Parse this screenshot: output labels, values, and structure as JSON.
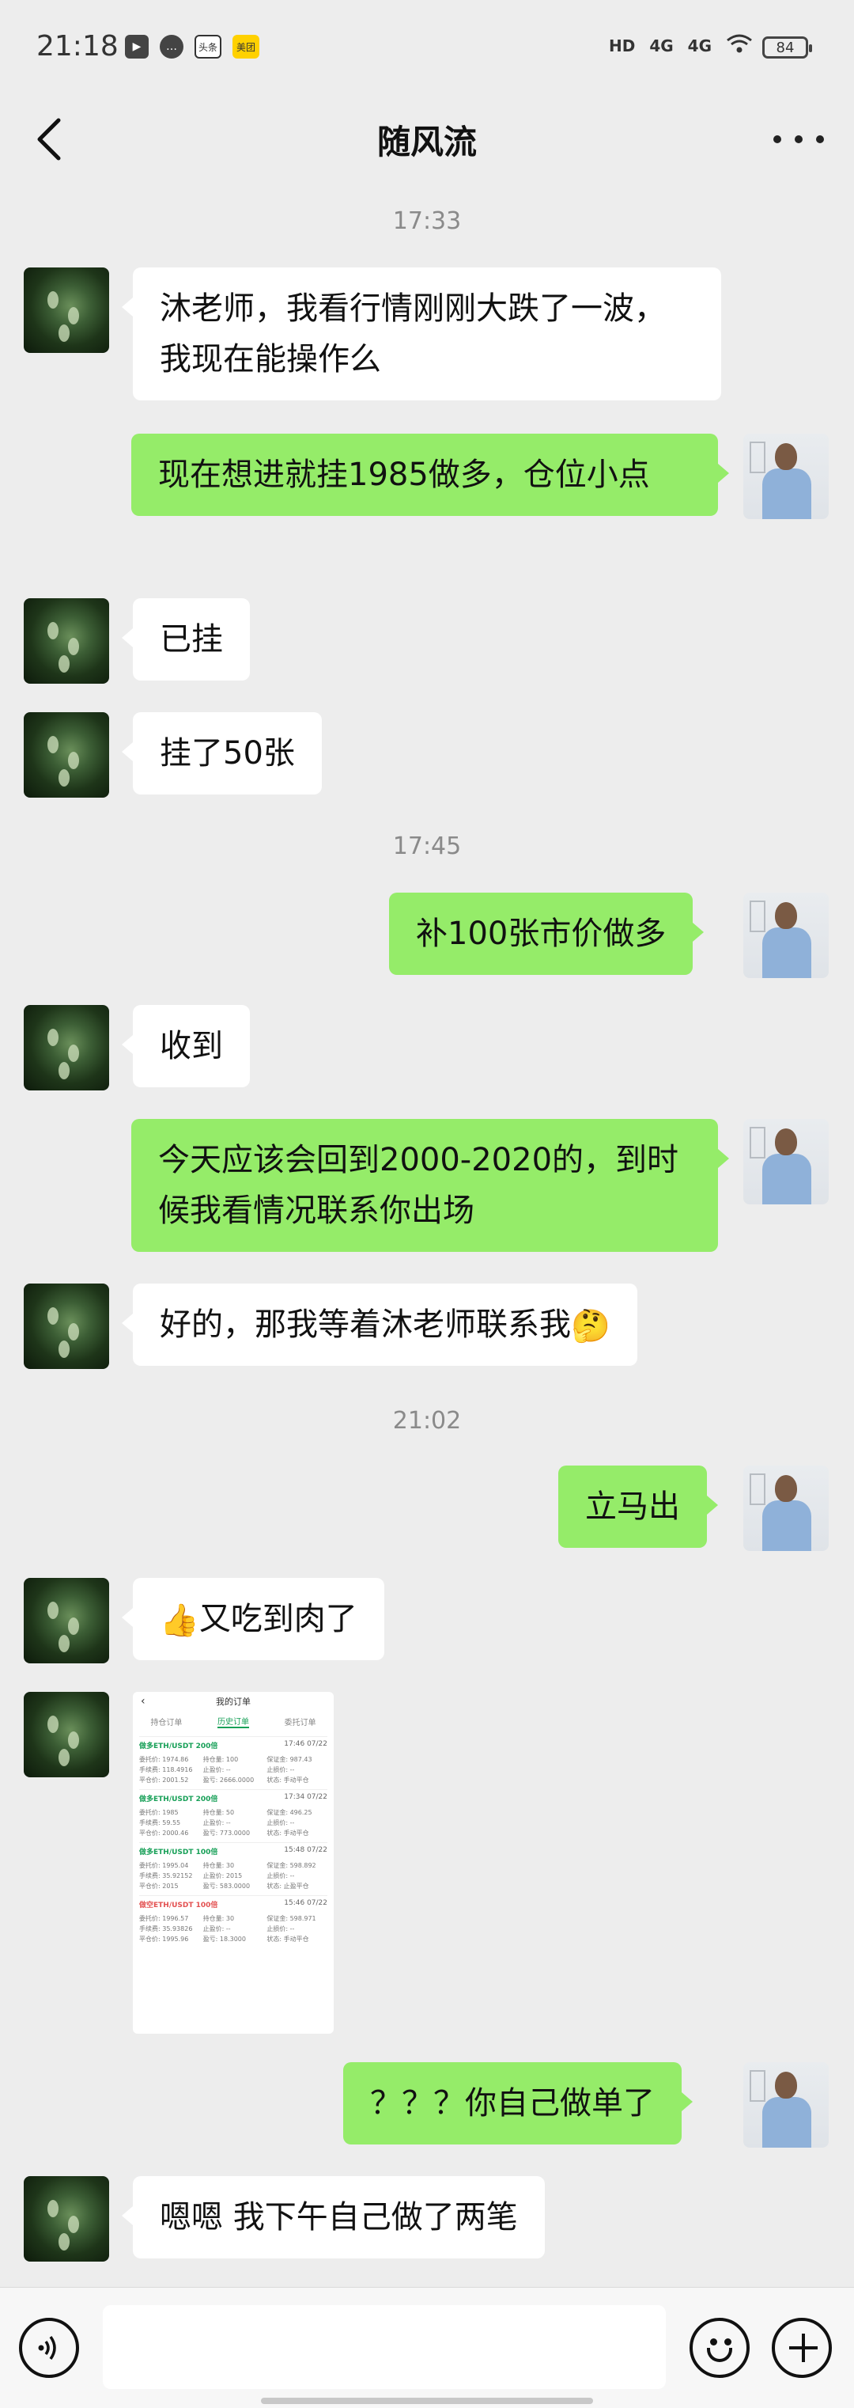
{
  "status_bar": {
    "time": "21:18",
    "icons_left": [
      "play-icon",
      "chat-bubble-icon",
      "toutiao-app-icon",
      "meituan-app-icon"
    ],
    "toutiao_label": "头条",
    "meituan_label": "美团",
    "hd_label": "HD",
    "signal1": "4G",
    "signal2": "4G",
    "battery": "84"
  },
  "header": {
    "title": "随风流"
  },
  "messages": [
    {
      "type": "time",
      "text": "17:33"
    },
    {
      "type": "text",
      "side": "left",
      "text": "沐老师，我看行情刚刚大跌了一波，我现在能操作么"
    },
    {
      "type": "text",
      "side": "right",
      "text": "现在想进就挂1985做多，仓位小点"
    },
    {
      "type": "text",
      "side": "left",
      "text": "已挂"
    },
    {
      "type": "text",
      "side": "left",
      "text": "挂了50张"
    },
    {
      "type": "time",
      "text": "17:45"
    },
    {
      "type": "text",
      "side": "right",
      "text": "补100张市价做多"
    },
    {
      "type": "text",
      "side": "left",
      "text": "收到"
    },
    {
      "type": "text",
      "side": "right",
      "text": "今天应该会回到2000-2020的，到时候我看情况联系你出场"
    },
    {
      "type": "text",
      "side": "left",
      "text": "好的，那我等着沐老师联系我",
      "emoji": "🤔"
    },
    {
      "type": "time",
      "text": "21:02"
    },
    {
      "type": "text",
      "side": "right",
      "text": "立马出"
    },
    {
      "type": "text",
      "side": "left",
      "emoji": "👍",
      "text": "又吃到肉了"
    },
    {
      "type": "image",
      "side": "left"
    },
    {
      "type": "text",
      "side": "right",
      "text": "？？？你自己做单了"
    },
    {
      "type": "text",
      "side": "left",
      "text": "嗯嗯 我下午自己做了两笔"
    }
  ],
  "image_message": {
    "title": "我的订单",
    "tabs": [
      "持仓订单",
      "历史订单",
      "委托订单"
    ],
    "orders": [
      {
        "name": "做多ETH/USDT 200倍",
        "time": "17:46 07/22",
        "color": "green",
        "fields": [
          "委托价: 1974.86",
          "持仓量: 100",
          "保证金: 987.43",
          "手续费: 118.4916",
          "止盈价: --",
          "止损价: --",
          "平仓价: 2001.52",
          "盈亏: 2666.0000",
          "状态: 手动平仓"
        ]
      },
      {
        "name": "做多ETH/USDT 200倍",
        "time": "17:34 07/22",
        "color": "green",
        "fields": [
          "委托价: 1985",
          "持仓量: 50",
          "保证金: 496.25",
          "手续费: 59.55",
          "止盈价: --",
          "止损价: --",
          "平仓价: 2000.46",
          "盈亏: 773.0000",
          "状态: 手动平仓"
        ]
      },
      {
        "name": "做多ETH/USDT 100倍",
        "time": "15:48 07/22",
        "color": "green",
        "fields": [
          "委托价: 1995.04",
          "持仓量: 30",
          "保证金: 598.892",
          "手续费: 35.92152",
          "止盈价: 2015",
          "止损价: --",
          "平仓价: 2015",
          "盈亏: 583.0000",
          "状态: 止盈平仓"
        ]
      },
      {
        "name": "做空ETH/USDT 100倍",
        "time": "15:46 07/22",
        "color": "red",
        "fields": [
          "委托价: 1996.57",
          "持仓量: 30",
          "保证金: 598.971",
          "手续费: 35.93826",
          "止盈价: --",
          "止损价: --",
          "平仓价: 1995.96",
          "盈亏: 18.3000",
          "状态: 手动平仓"
        ]
      }
    ]
  },
  "input_bar": {
    "placeholder": ""
  },
  "colors": {
    "background": "#ededed",
    "bubble_right": "#95ec69",
    "bubble_left": "#ffffff",
    "timestamp": "#8a8a8a"
  }
}
